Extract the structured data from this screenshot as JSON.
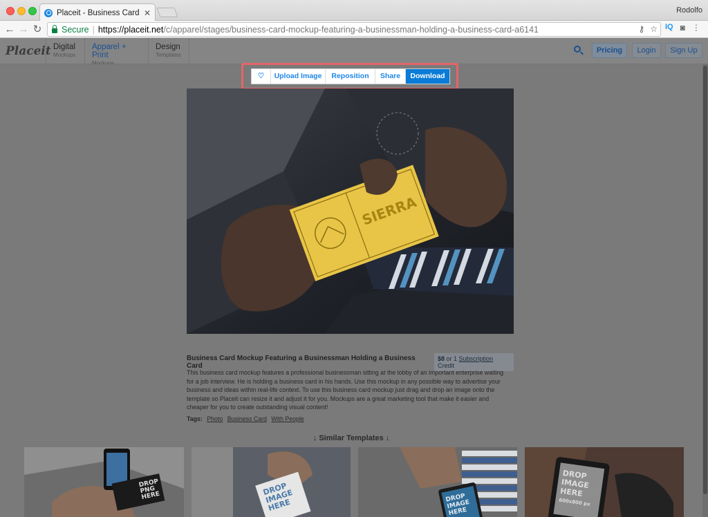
{
  "browser": {
    "tab_title": "Placeit - Business Card Mocku",
    "profile": "Rodolfo",
    "secure_label": "Secure",
    "url_host": "https://placeit.net",
    "url_path": "/c/apparel/stages/business-card-mockup-featuring-a-businessman-holding-a-business-card-a6141",
    "ext_iq": "IQ"
  },
  "header": {
    "logo": "Placeit",
    "nav": [
      {
        "label": "Digital",
        "sub": "Mockups"
      },
      {
        "label": "Apparel + Print",
        "sub": "Mockups"
      },
      {
        "label": "Design",
        "sub": "Templates"
      }
    ],
    "pricing": "Pricing",
    "login": "Login",
    "signup": "Sign Up"
  },
  "actions": {
    "favorite_icon": "heart-icon",
    "upload": "Upload Image",
    "reposition": "Reposition",
    "share": "Share",
    "download": "Download"
  },
  "card": {
    "brand": "SIERRA",
    "colors": {
      "card": "#e8c547",
      "card_ink": "#8c6f10"
    }
  },
  "product": {
    "title": "Business Card Mockup Featuring a Businessman Holding a Business Card",
    "price_amount": "$8",
    "price_or": " or 1 ",
    "price_link": "Subscription",
    "price_suffix": " Credit",
    "description": "This business card mockup features a professional businessman sitting at the lobby of an important enterprise waiting for a job interview. He is holding a business card in his hands. Use this mockup in any possible way to advertise your business and ideas within real-life context. To use this business card mockup just drag and drop an image onto the template so Placeit can resize it and adjust it for you. Mockups are a great marketing tool that make it easier and cheaper for you to create outstanding visual content!",
    "tags_label": "Tags:",
    "tags": [
      "Photo",
      "Business Card",
      "With People"
    ]
  },
  "similar": {
    "heading": "↓ Similar Templates ↓",
    "items": [
      {
        "text1": "DROP",
        "text2": "PNG",
        "text3": "HERE"
      },
      {
        "text1": "DROP",
        "text2": "IMAGE",
        "text3": "HERE"
      },
      {
        "text1": "DROP",
        "text2": "IMAGE",
        "text3": "HERE"
      },
      {
        "text1": "DROP",
        "text2": "IMAGE",
        "text3": "HERE",
        "text4": "600x800 px"
      }
    ]
  }
}
